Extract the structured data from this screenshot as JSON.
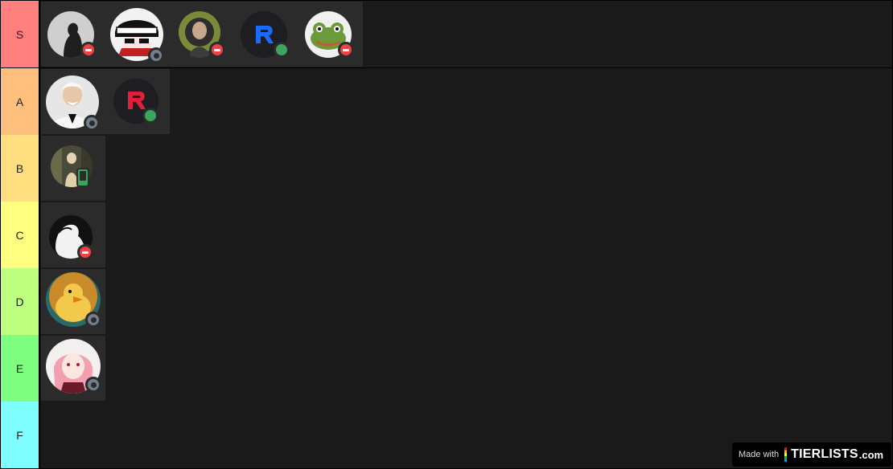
{
  "tiers": [
    {
      "label": "S",
      "color": "#ff7f7f",
      "items": [
        {
          "avatar": "avatar-silhouette-icon",
          "status": "dnd"
        },
        {
          "avatar": "avatar-anime-bandana-icon",
          "status": "offline"
        },
        {
          "avatar": "avatar-green-hood-icon",
          "status": "dnd"
        },
        {
          "avatar": "avatar-blue-r-logo-icon",
          "status": "online"
        },
        {
          "avatar": "avatar-frog-icon",
          "status": "dnd"
        }
      ]
    },
    {
      "label": "A",
      "color": "#ffbf7f",
      "items": [
        {
          "avatar": "avatar-colonel-icon",
          "status": "offline"
        },
        {
          "avatar": "avatar-red-r-logo-icon",
          "status": "online"
        }
      ]
    },
    {
      "label": "B",
      "color": "#ffdf7f",
      "items": [
        {
          "avatar": "avatar-forest-figure-icon",
          "status": "mobile"
        }
      ]
    },
    {
      "label": "C",
      "color": "#ffff7f",
      "items": [
        {
          "avatar": "avatar-bw-silhouette-icon",
          "status": "dnd"
        }
      ]
    },
    {
      "label": "D",
      "color": "#bfff7f",
      "items": [
        {
          "avatar": "avatar-duck-icon",
          "status": "offline"
        }
      ]
    },
    {
      "label": "E",
      "color": "#7fff7f",
      "items": [
        {
          "avatar": "avatar-anime-girl-icon",
          "status": "offline"
        }
      ]
    },
    {
      "label": "F",
      "color": "#7fffff",
      "items": []
    }
  ],
  "badge": {
    "made_with": "Made with",
    "brand": "TIERLISTS",
    "tld": ".com"
  }
}
